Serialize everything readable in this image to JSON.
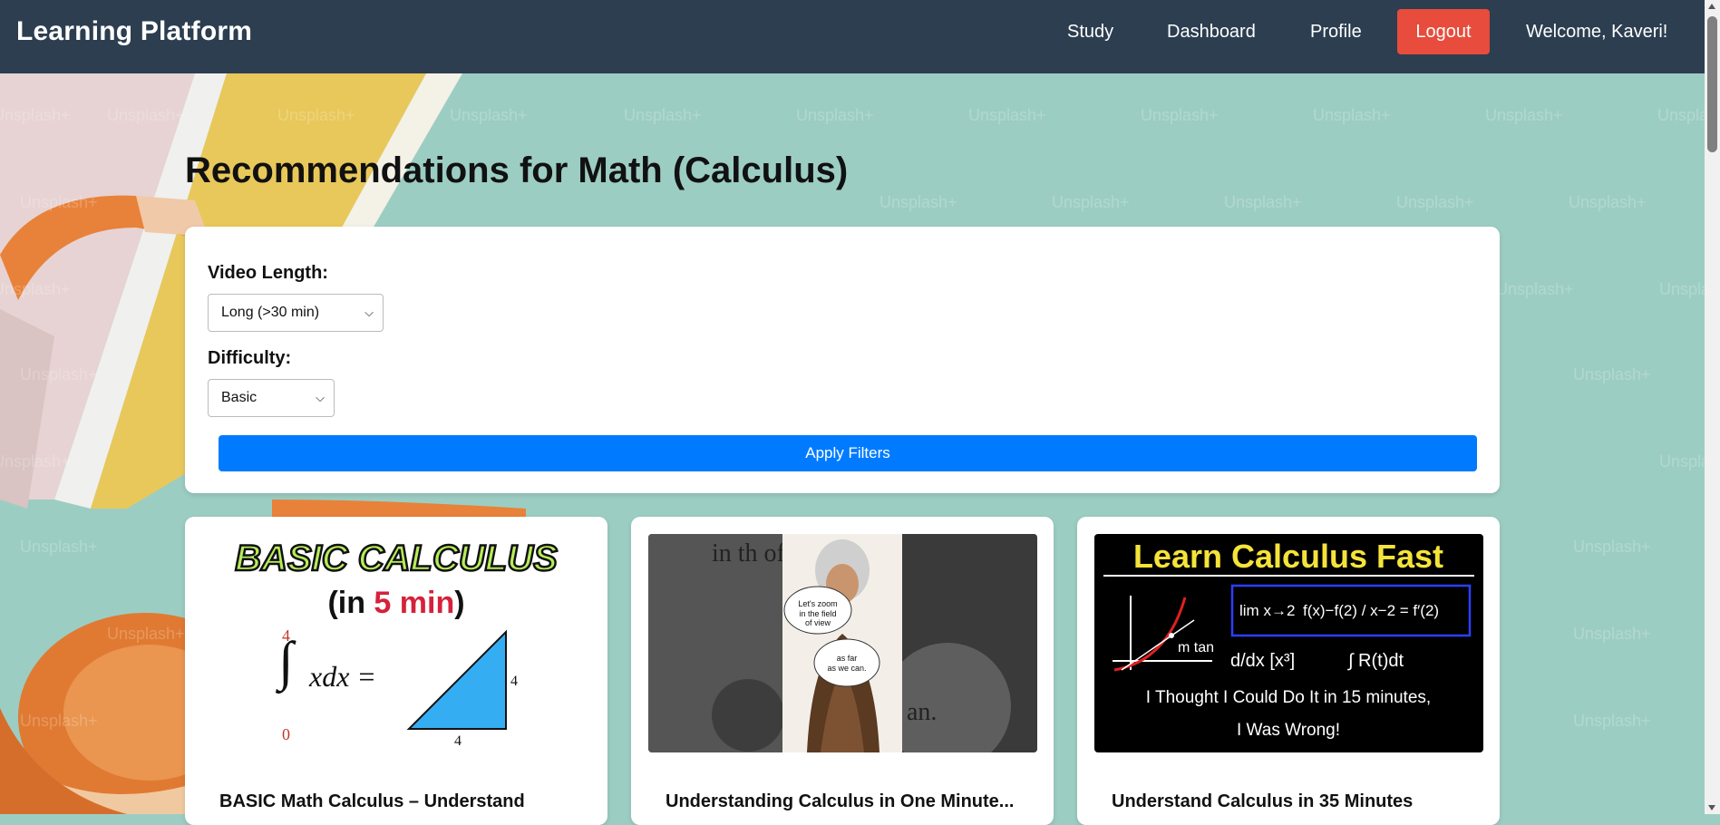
{
  "header": {
    "brand": "Learning Platform",
    "nav": [
      "Study",
      "Dashboard",
      "Profile"
    ],
    "logout_label": "Logout",
    "welcome": "Welcome, Kaveri!"
  },
  "page_title": "Recommendations for Math (Calculus)",
  "filters": {
    "video_length_label": "Video Length:",
    "video_length_value": "Long (>30 min)",
    "difficulty_label": "Difficulty:",
    "difficulty_value": "Basic",
    "apply_label": "Apply Filters"
  },
  "watermark": "Unsplash+",
  "videos": [
    {
      "title": "BASIC Math Calculus – Understand",
      "thumb": {
        "heading": "BASIC CALCULUS",
        "sub_prefix": "(in ",
        "sub_highlight": "5 min",
        "sub_suffix": ")",
        "upper_limit": "4",
        "lower_limit": "0",
        "integrand": "xdx =",
        "side_label": "4",
        "base_label": "4"
      }
    },
    {
      "title": "Understanding Calculus in One Minute...",
      "thumb": {
        "bubble_top": "Let's zoom in the field of view",
        "bubble_bottom": "as far as we can.",
        "bg_text_top": "in th of",
        "bg_text_bottom": "an."
      }
    },
    {
      "title": "Understand Calculus in 35 Minutes",
      "thumb": {
        "heading": "Learn Calculus Fast",
        "formula": "f(x)−f(2) / x−2 = f′(2)",
        "limit": "lim x→2",
        "tangent": "m tan",
        "deriv": "d/dx [x³]",
        "integral": "∫ R(t)dt",
        "line1": "I Thought I Could Do It in 15 minutes,",
        "line2": "I Was Wrong!"
      }
    }
  ],
  "colors": {
    "header_bg": "#2c3e50",
    "logout_bg": "#e74c3c",
    "apply_bg": "#007bff",
    "page_bg": "#9ccdc3"
  }
}
